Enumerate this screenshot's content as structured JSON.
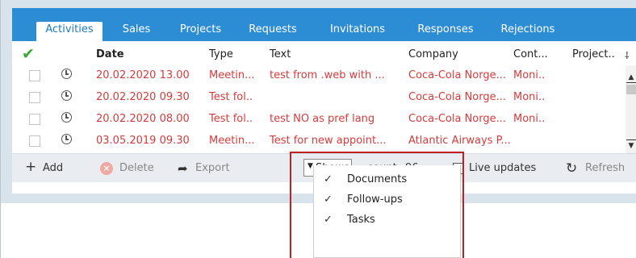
{
  "tabs": [
    {
      "label": "Activities",
      "active": true
    },
    {
      "label": "Sales"
    },
    {
      "label": "Projects"
    },
    {
      "label": "Requests"
    },
    {
      "label": "Invitations"
    },
    {
      "label": "Responses"
    },
    {
      "label": "Rejections"
    }
  ],
  "columns": {
    "check_icon": "checkmark-icon",
    "date": "Date",
    "type": "Type",
    "text": "Text",
    "company": "Company",
    "contact": "Cont...",
    "project": "Project..",
    "pin": "⸸"
  },
  "rows": [
    {
      "date": "20.02.2020 13.00",
      "type": "Meetin...",
      "text": "test from .web with ...",
      "company": "Coca-Cola Norge...",
      "contact": "Moni.."
    },
    {
      "date": "20.02.2020 09.30",
      "type": "Test fol..",
      "text": "",
      "company": "Coca-Cola Norge...",
      "contact": "Moni.."
    },
    {
      "date": "20.02.2020 08.00",
      "type": "Test fol..",
      "text": "test NO as pref lang",
      "company": "Coca-Cola Norge...",
      "contact": "Moni.."
    },
    {
      "date": "03.05.2019 09.30",
      "type": "Meetin...",
      "text": "Test for new appoint...",
      "company": "Atlantic Airways P...",
      "contact": ""
    }
  ],
  "toolbar": {
    "add": "Add",
    "delete": "Delete",
    "export": "Export",
    "shows": "Shows",
    "count_label": "count",
    "count_value": "96",
    "live_updates": "Live updates",
    "refresh": "Refresh"
  },
  "shows_menu": [
    {
      "label": "Documents",
      "checked": true
    },
    {
      "label": "Follow-ups",
      "checked": true
    },
    {
      "label": "Tasks",
      "checked": true
    }
  ],
  "colors": {
    "accent": "#2c8dd5",
    "row_text": "#d63b3b",
    "check_green": "#3aa935",
    "highlight": "#c0201f"
  }
}
